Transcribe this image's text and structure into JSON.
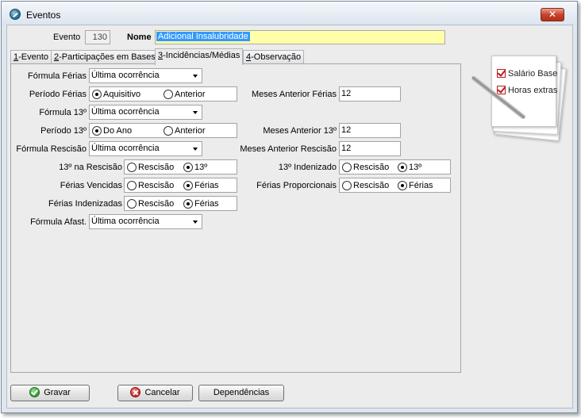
{
  "window": {
    "title": "Eventos",
    "close_glyph": "✕"
  },
  "header": {
    "evento_label": "Evento",
    "evento_value": "130",
    "nome_label": "Nome",
    "nome_value": "Adicional Insalubridade"
  },
  "tabs": [
    {
      "key": "1",
      "label": "-Evento"
    },
    {
      "key": "2",
      "label": "-Participações em Bases"
    },
    {
      "key": "3",
      "label": "-Incidências/Médias",
      "active": true
    },
    {
      "key": "4",
      "label": "-Observação"
    }
  ],
  "form": {
    "formula_ferias": {
      "label": "Fórmula Férias",
      "value": "Última ocorrência"
    },
    "periodo_ferias": {
      "label": "Período Férias",
      "options": [
        "Aquisitivo",
        "Anterior"
      ],
      "selected": "Aquisitivo"
    },
    "meses_anterior_ferias": {
      "label": "Meses Anterior Férias",
      "value": "12"
    },
    "formula_13": {
      "label": "Fórmula 13º",
      "value": "Última ocorrência"
    },
    "periodo_13": {
      "label": "Período 13º",
      "options": [
        "Do Ano",
        "Anterior"
      ],
      "selected": "Do Ano"
    },
    "meses_anterior_13": {
      "label": "Meses Anterior 13º",
      "value": "12"
    },
    "formula_rescisao": {
      "label": "Fórmula Rescisão",
      "value": "Última ocorrência"
    },
    "meses_anterior_rescisao": {
      "label": "Meses Anterior Rescisão",
      "value": "12"
    },
    "na_rescisao_13": {
      "label": "13º na Rescisão",
      "options": [
        "Rescisão",
        "13º"
      ],
      "selected": "13º"
    },
    "indenizado_13": {
      "label": "13º Indenizado",
      "options": [
        "Rescisão",
        "13º"
      ],
      "selected": "13º"
    },
    "ferias_vencidas": {
      "label": "Férias Vencidas",
      "options": [
        "Rescisão",
        "Férias"
      ],
      "selected": "Férias"
    },
    "ferias_proporcionais": {
      "label": "Férias Proporcionais",
      "options": [
        "Rescisão",
        "Férias"
      ],
      "selected": "Férias"
    },
    "ferias_indenizadas": {
      "label": "Férias Indenizadas",
      "options": [
        "Rescisão",
        "Férias"
      ],
      "selected": "Férias"
    },
    "formula_afast": {
      "label": "Fórmula Afast.",
      "value": "Última ocorrência"
    }
  },
  "notepad": {
    "items": [
      "Salário Base",
      "Horas extras"
    ]
  },
  "buttons": {
    "gravar": "Gravar",
    "cancelar": "Cancelar",
    "dependencias": "Dependências"
  },
  "colors": {
    "name_field_bg": "#ffffa8",
    "selection": "#3399ff",
    "close_button": "#c8432b"
  }
}
